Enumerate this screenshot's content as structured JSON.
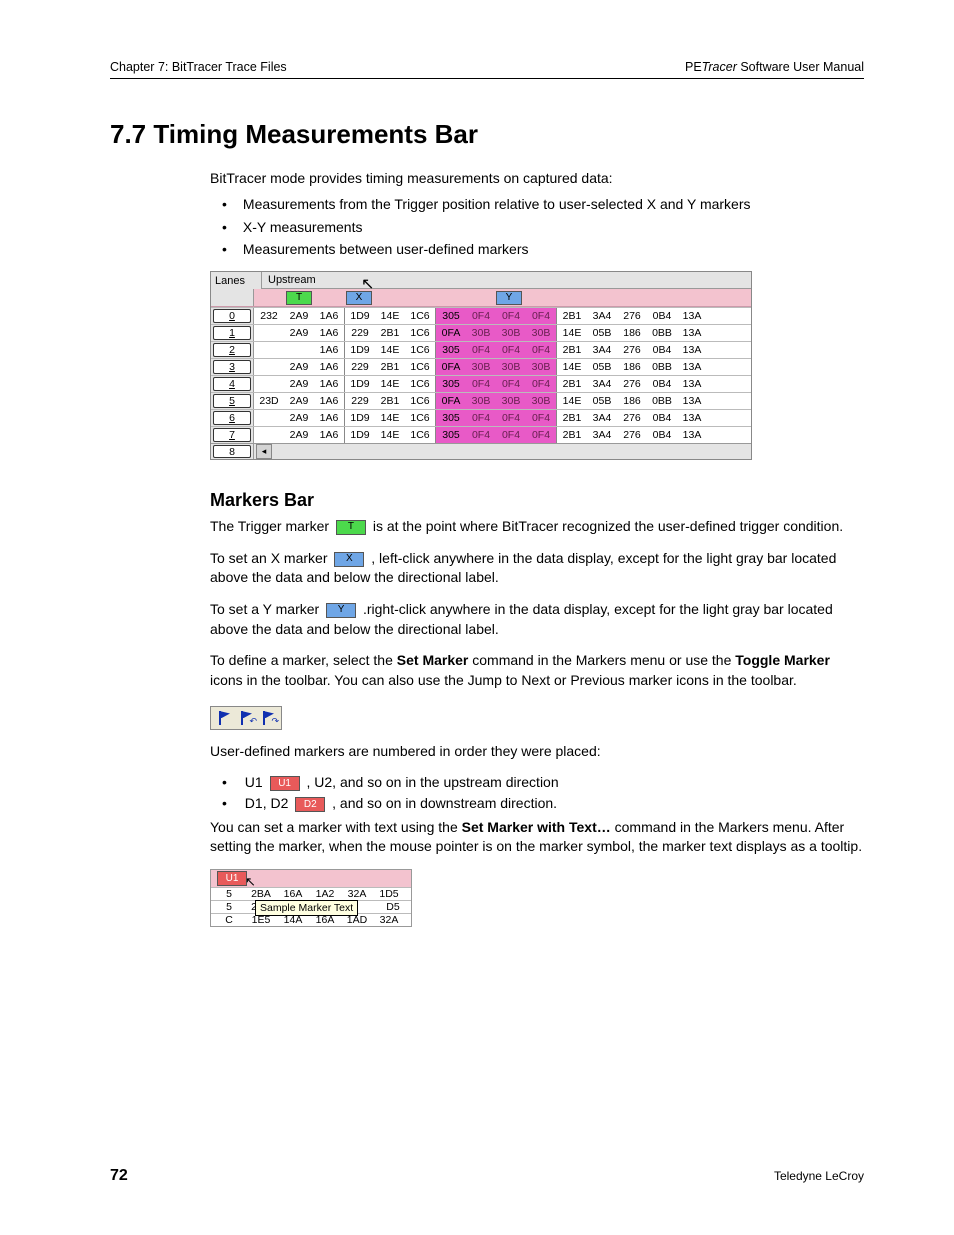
{
  "header": {
    "left": "Chapter 7: BitTracer Trace Files",
    "right_pe": "PE",
    "right_tracer": "Tracer",
    "right_rest": " Software User Manual"
  },
  "section_title": "7.7 Timing Measurements Bar",
  "intro": "BitTracer mode provides timing measurements on captured data:",
  "bullets": [
    "Measurements from the Trigger position relative to user-selected X and Y markers",
    "X-Y measurements",
    "Measurements between user-defined markers"
  ],
  "trace": {
    "lanes_label": "Lanes",
    "direction": "Upstream",
    "markers": {
      "T": "T",
      "X": "X",
      "Y": "Y"
    },
    "lanes": [
      "0",
      "1",
      "2",
      "3",
      "4",
      "5",
      "6",
      "7",
      "8"
    ],
    "rows": [
      {
        "lane": "0",
        "head": "232",
        "grp1": [
          "2A9",
          "1A6"
        ],
        "grp2": [
          "1D9",
          "14E",
          "1C6"
        ],
        "hl": [
          "305",
          "0F4",
          "0F4",
          "0F4"
        ],
        "grp3": [
          "2B1",
          "3A4",
          "276",
          "0B4",
          "13A"
        ]
      },
      {
        "lane": "1",
        "head": "",
        "grp1": [
          "2A9",
          "1A6"
        ],
        "grp2": [
          "229",
          "2B1",
          "1C6"
        ],
        "hl": [
          "0FA",
          "30B",
          "30B",
          "30B"
        ],
        "grp3": [
          "14E",
          "05B",
          "186",
          "0BB",
          "13A"
        ]
      },
      {
        "lane": "2",
        "head": "",
        "grp1": [
          "",
          "1A6"
        ],
        "grp2": [
          "1D9",
          "14E",
          "1C6"
        ],
        "hl": [
          "305",
          "0F4",
          "0F4",
          "0F4"
        ],
        "grp3": [
          "2B1",
          "3A4",
          "276",
          "0B4",
          "13A"
        ]
      },
      {
        "lane": "3",
        "head": "",
        "grp1": [
          "2A9",
          "1A6"
        ],
        "grp2": [
          "229",
          "2B1",
          "1C6"
        ],
        "hl": [
          "0FA",
          "30B",
          "30B",
          "30B"
        ],
        "grp3": [
          "14E",
          "05B",
          "186",
          "0BB",
          "13A"
        ]
      },
      {
        "lane": "4",
        "head": "",
        "grp1": [
          "2A9",
          "1A6"
        ],
        "grp2": [
          "1D9",
          "14E",
          "1C6"
        ],
        "hl": [
          "305",
          "0F4",
          "0F4",
          "0F4"
        ],
        "grp3": [
          "2B1",
          "3A4",
          "276",
          "0B4",
          "13A"
        ]
      },
      {
        "lane": "5",
        "head": "23D",
        "grp1": [
          "2A9",
          "1A6"
        ],
        "grp2": [
          "229",
          "2B1",
          "1C6"
        ],
        "hl": [
          "0FA",
          "30B",
          "30B",
          "30B"
        ],
        "grp3": [
          "14E",
          "05B",
          "186",
          "0BB",
          "13A"
        ]
      },
      {
        "lane": "6",
        "head": "",
        "grp1": [
          "2A9",
          "1A6"
        ],
        "grp2": [
          "1D9",
          "14E",
          "1C6"
        ],
        "hl": [
          "305",
          "0F4",
          "0F4",
          "0F4"
        ],
        "grp3": [
          "2B1",
          "3A4",
          "276",
          "0B4",
          "13A"
        ]
      },
      {
        "lane": "7",
        "head": "",
        "grp1": [
          "2A9",
          "1A6"
        ],
        "grp2": [
          "1D9",
          "14E",
          "1C6"
        ],
        "hl": [
          "305",
          "0F4",
          "0F4",
          "0F4"
        ],
        "grp3": [
          "2B1",
          "3A4",
          "276",
          "0B4",
          "13A"
        ]
      }
    ]
  },
  "subheading": "Markers Bar",
  "para_trigger_a": "The Trigger marker ",
  "para_trigger_b": " is at the point where BitTracer recognized the user-defined trigger condition.",
  "para_x_a": "To set an X marker ",
  "para_x_b": ", left-click anywhere in the data display, except for the light gray bar located above the data and below the directional label.",
  "para_y_a": "To set a Y marker ",
  "para_y_b": ".right-click anywhere in the data display, except for the light gray bar located above the data and below the directional label.",
  "para_define_a": "To define a marker, select the ",
  "para_define_b": "Set Marker",
  "para_define_c": " command in the Markers menu or use the ",
  "para_define_d": "Toggle Marker",
  "para_define_e": " icons in the toolbar. You can also use the Jump to Next or Previous marker icons in the toolbar.",
  "para_userdef": "User-defined markers are numbered in order they were placed:",
  "sub_bullets": {
    "u_pre": "U1 ",
    "u_label": "U1",
    "u_post": ", U2, and so on in the upstream direction",
    "d_pre": "D1, D2 ",
    "d_label": "D2",
    "d_post": ", and so on in downstream direction."
  },
  "para_setmarker_a": "You can set a marker with text using the ",
  "para_setmarker_b": "Set Marker with Text…",
  "para_setmarker_c": " command in the Markers menu. After setting the marker, when the mouse pointer is on the marker symbol, the marker text displays as a tooltip.",
  "tooltip_sample": {
    "marker": "U1",
    "rows": [
      [
        "5",
        "2BA",
        "16A",
        "1A2",
        "32A",
        "1D5"
      ],
      [
        "5",
        "2BA",
        "",
        "",
        "",
        "D5"
      ],
      [
        "C",
        "1E5",
        "14A",
        "16A",
        "1AD",
        "32A"
      ]
    ],
    "tip": "Sample Marker Text"
  },
  "footer": {
    "page": "72",
    "company": "Teledyne LeCroy"
  }
}
